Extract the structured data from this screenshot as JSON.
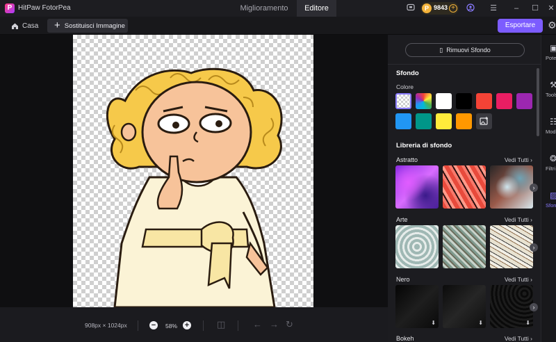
{
  "app": {
    "name": "HitPaw FotorPea",
    "logo_letter": "P",
    "tabs": [
      {
        "label": "Miglioramento",
        "active": false
      },
      {
        "label": "Editore",
        "active": true
      }
    ],
    "credits": "9843"
  },
  "toolbar": {
    "home_label": "Casa",
    "replace_label": "Sostituisci Immagine",
    "export_label": "Esportare"
  },
  "bottom": {
    "dimensions": "908px × 1024px",
    "zoom": "58%"
  },
  "panel": {
    "remove_bg_label": "Rimuovi Sfondo",
    "background_title": "Sfondo",
    "color_label": "Colore",
    "colors": [
      "transparent",
      "rainbow",
      "#ffffff",
      "#000000",
      "#f44336",
      "#e91e63",
      "#9c27b0",
      "#2196f3",
      "#009688",
      "#ffeb3b",
      "#ff9800",
      "add-image"
    ],
    "library_title": "Libreria di sfondo",
    "see_all": "Vedi Tutti",
    "libraries": [
      {
        "name": "Astratto"
      },
      {
        "name": "Arte"
      },
      {
        "name": "Nero"
      },
      {
        "name": "Bokeh"
      }
    ]
  },
  "rail": [
    {
      "label": "Potenz",
      "icon": "enhance-icon"
    },
    {
      "label": "Tools",
      "icon": "tools-icon"
    },
    {
      "label": "Modif",
      "icon": "sliders-icon"
    },
    {
      "label": "Filtri",
      "icon": "filter-icon"
    },
    {
      "label": "Sfondo",
      "icon": "background-icon",
      "active": true
    }
  ]
}
